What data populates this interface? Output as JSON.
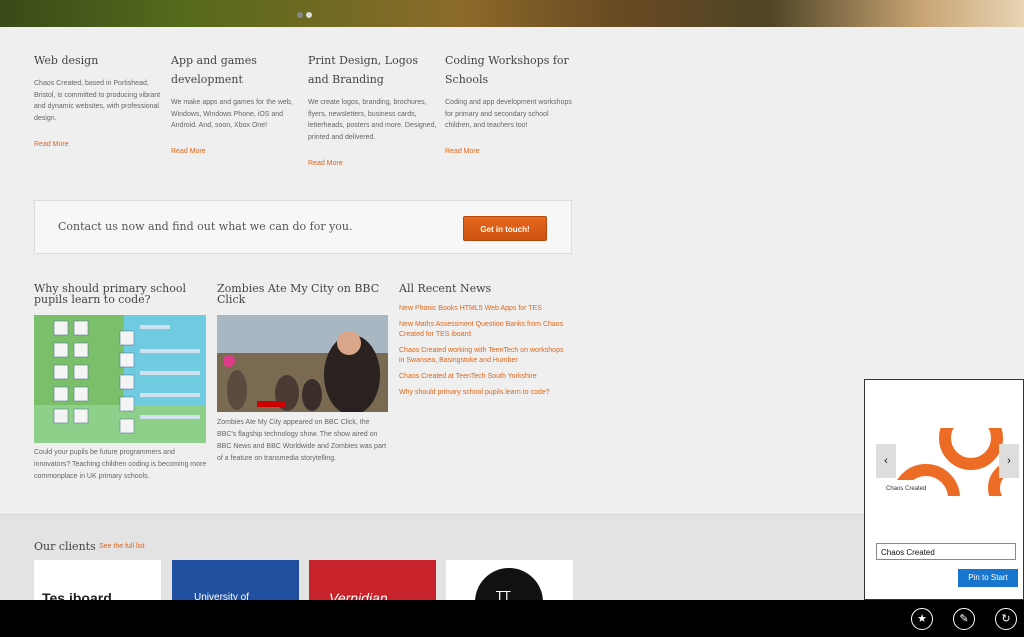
{
  "services": [
    {
      "title": "Web design",
      "body": "Chaos Created, based in Portishead, Bristol, is committed to producing vibrant and dynamic websites, with professional design.",
      "link": "Read More"
    },
    {
      "title": "App and games development",
      "body": "We make apps and games for the web, Windows, Windows Phone, iOS and Android. And, soon, Xbox One!",
      "link": "Read More"
    },
    {
      "title": "Print Design, Logos and Branding",
      "body": "We create logos, branding, brochures, flyers, newsletters, business cards, letterheads, posters and more. Designed, printed and delivered.",
      "link": "Read More"
    },
    {
      "title": "Coding Workshops for Schools",
      "body": "Coding and app development workshops for primary and secondary school children, and teachers too!",
      "link": "Read More"
    }
  ],
  "contact": {
    "text": "Contact us now and find out what we can do for you.",
    "button": "Get in touch!"
  },
  "news": {
    "primary": {
      "title": "Why should primary school pupils learn to code?",
      "caption": "Could your pupils be future programmers and innovators? Teaching children coding is becoming more commonplace in UK primary schools."
    },
    "zombies": {
      "title": "Zombies Ate My City on BBC Click",
      "caption": "Zombies Ate My City appeared on BBC Click, the BBC's flagship technology show. The show aired on BBC News and BBC Worldwide and Zombies was part of a feature on transmedia storytelling."
    },
    "recent_title": "All Recent News",
    "recent": [
      "New Phonic Books HTML5 Web Apps for TES",
      "New Maths Assessment Question Banks from Chaos Created for TES iboard",
      "Chaos Created working with TeenTech on workshops in Swansea, Basingstoke and Humber",
      "Chaos Created at TeenTech South Yorkshire",
      "Why should primary school pupils learn to code?"
    ]
  },
  "clients": {
    "title": "Our clients",
    "link": "See the full list",
    "logos": [
      "Tes iboard",
      "University of",
      "Vernidian",
      "TT"
    ]
  },
  "flyout": {
    "tile_name": "Chaos Created",
    "name_value": "Chaos Created",
    "pin_button": "Pin to Start",
    "prev": "‹",
    "next": "›"
  },
  "appbar": {
    "icons": [
      "favorites-icon",
      "pin-icon",
      "refresh-icon"
    ]
  },
  "colors": {
    "accent": "#e0661a",
    "pin_blue": "#1976cf"
  }
}
